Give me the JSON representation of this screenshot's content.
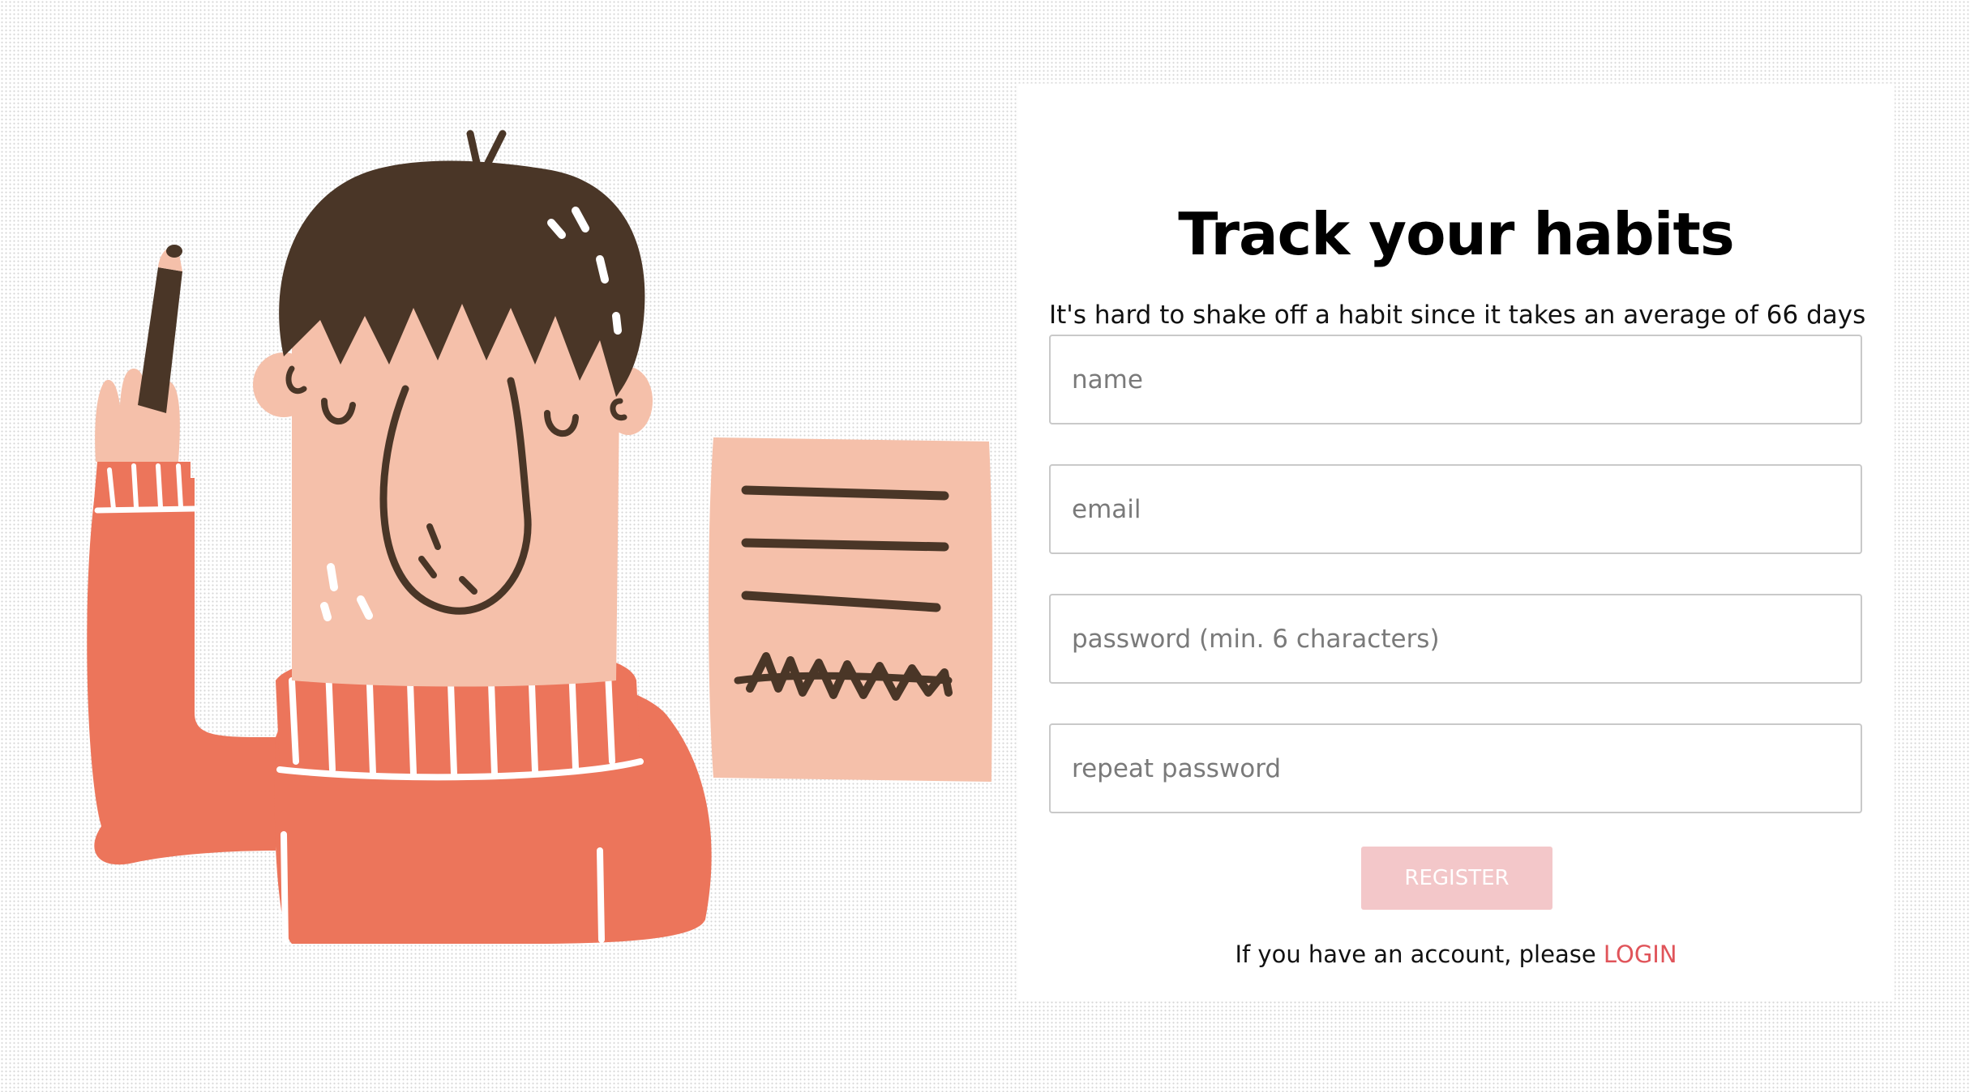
{
  "header": {
    "title": "Track your habits",
    "description": "It's hard to shake off a habit since it takes an average of 66 days before a new habit takes root in our brain. Make it easier."
  },
  "form": {
    "name_placeholder": "name",
    "email_placeholder": "email",
    "password_placeholder": "password (min. 6 characters)",
    "repeat_password_placeholder": "repeat password",
    "register_label": "REGISTER"
  },
  "footer": {
    "prompt": "If you have an account, please ",
    "login_label": "LOGIN"
  },
  "illustration": {
    "icon": "person-with-pencil-and-note-illustration",
    "note_scribble": "AAAAA"
  },
  "colors": {
    "accent": "#e0545a",
    "register_button": "#f3c7c9",
    "sweater": "#ec755b",
    "skin": "#f5c0aa",
    "hair": "#4a3627"
  }
}
